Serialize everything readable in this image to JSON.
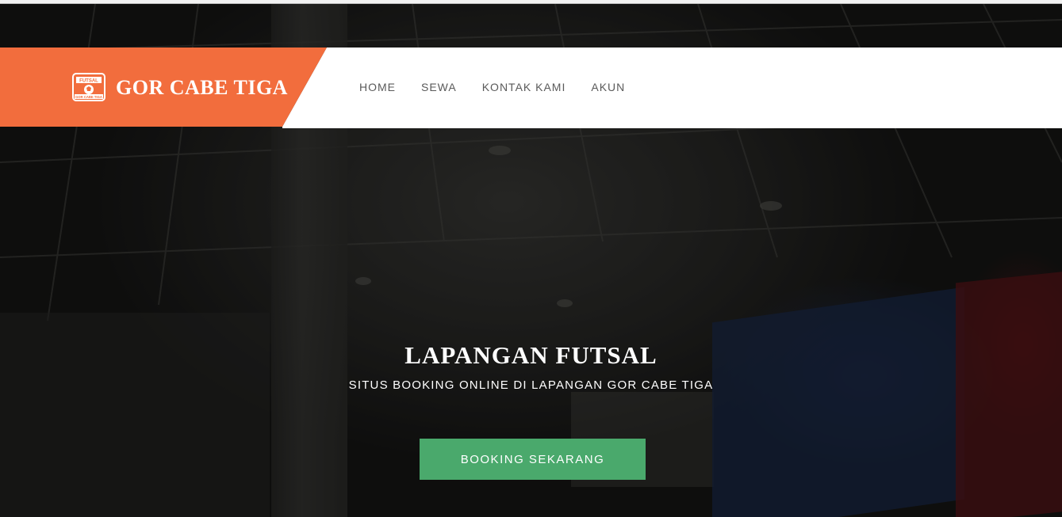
{
  "brand": {
    "name": "GOR CABE TIGA",
    "logo_text_top": "FUTSAL",
    "logo_text_bottom": "GOR CABE TIGA",
    "accent": "#f26d3d"
  },
  "nav": {
    "items": [
      {
        "label": "HOME"
      },
      {
        "label": "SEWA"
      },
      {
        "label": "KONTAK KAMI"
      },
      {
        "label": "AKUN"
      }
    ]
  },
  "hero": {
    "title": "LAPANGAN FUTSAL",
    "subtitle": "SITUS BOOKING ONLINE DI LAPANGAN GOR CABE TIGA",
    "cta_label": "BOOKING SEKARANG",
    "cta_color": "#4aa96c"
  }
}
